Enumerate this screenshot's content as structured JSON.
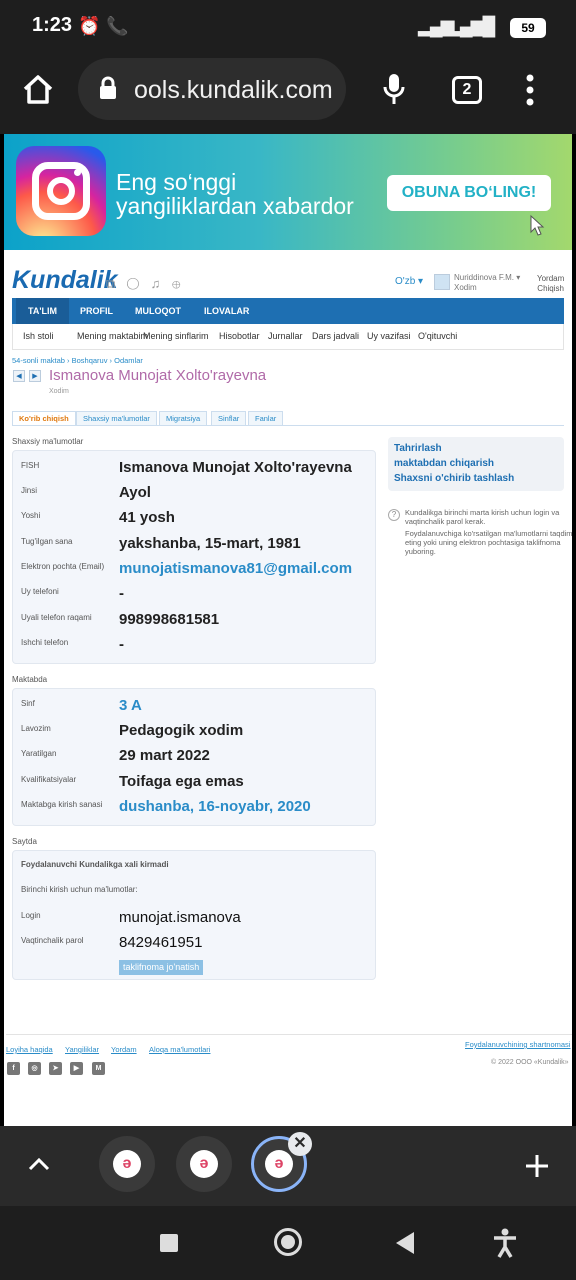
{
  "status": {
    "time": "1:23",
    "battery": "59"
  },
  "browser": {
    "url": "ools.kundalik.com",
    "tab_count": "2"
  },
  "banner": {
    "line1": "Eng so‘nggi",
    "line2": "yangiliklardan xabardor",
    "button": "OBUNA BO‘LING!"
  },
  "header": {
    "logo": "Kundalik",
    "lang": "O'zb ▾",
    "user_name": "Nuriddinova F.M. ▾",
    "user_role": "Xodim",
    "help": "Yordam",
    "logout": "Chiqish"
  },
  "mainnav": [
    "TA'LIM",
    "PROFIL",
    "MULOQOT",
    "ILOVALAR"
  ],
  "subnav": [
    "Ish stoli",
    "Mening maktabim",
    "Mening sinflarim",
    "Hisobotlar",
    "Jurnallar",
    "Dars jadvali",
    "Uy vazifasi",
    "O'qituvchi"
  ],
  "breadcrumbs": "54-sonli maktab  ›  Boshqaruv  ›  Odamlar",
  "person": {
    "name": "Ismanova Munojat Xolto'rayevna",
    "role": "Xodim"
  },
  "tabs": [
    "Ko'rib chiqish",
    "Shaxsiy ma'lumotlar",
    "Migratsiya",
    "Sinflar",
    "Fanlar"
  ],
  "personal": {
    "title": "Shaxsiy ma'lumotlar",
    "rows": [
      {
        "label": "FISH",
        "value": "Ismanova Munojat Xolto'rayevna"
      },
      {
        "label": "Jinsi",
        "value": "Ayol"
      },
      {
        "label": "Yoshi",
        "value": "41 yosh"
      },
      {
        "label": "Tug'ilgan sana",
        "value": "yakshanba, 15-mart, 1981"
      },
      {
        "label": "Elektron pochta (Email)",
        "value": "munojatismanova81@gmail.com"
      },
      {
        "label": "Uy telefoni",
        "value": "-"
      },
      {
        "label": "Uyali telefon raqami",
        "value": "998998681581"
      },
      {
        "label": "Ishchi telefon",
        "value": "-"
      }
    ]
  },
  "school": {
    "title": "Maktabda",
    "rows": [
      {
        "label": "Sinf",
        "value": "3 A"
      },
      {
        "label": "Lavozim",
        "value": "Pedagogik xodim"
      },
      {
        "label": "Yaratilgan",
        "value": "29 mart 2022"
      },
      {
        "label": "Kvalifikatsiyalar",
        "value": "Toifaga ega emas"
      },
      {
        "label": "Maktabga kirish sanasi",
        "value": "dushanba, 16-noyabr, 2020"
      }
    ]
  },
  "site": {
    "title": "Saytda",
    "notice": "Foydalanuvchi Kundalikga xali kirmadi",
    "first_login": "Birinchi kirish uchun ma'lumotlar:",
    "login_label": "Login",
    "login_value": "munojat.ismanova",
    "password_label": "Vaqtinchalik parol",
    "password_value": "8429461951",
    "invite_button": "taklifnoma jo'natish"
  },
  "side": {
    "edit": "Tahrirlash",
    "remove": "maktabdan chiqarish",
    "delete": "Shaxsni o'chirib tashlash",
    "info1": "Kundalikga birinchi marta kirish uchun login va vaqtinchalik parol kerak.",
    "info2": "Foydalanuvchiga ko'rsatilgan ma'lumotlarni taqdim eting yoki uning elektron pochtasiga taklifnoma yuboring."
  },
  "footer": {
    "links": [
      "Loyiha haqida",
      "Yangiliklar",
      "Yordam",
      "Aloqa ma'lumotlari"
    ],
    "agreement": "Foydalanuvchining shartnomasi",
    "copyright": "© 2022 OOO «Kundalik»",
    "socials": [
      "f",
      "◎",
      "➤",
      "▶",
      "M"
    ]
  }
}
